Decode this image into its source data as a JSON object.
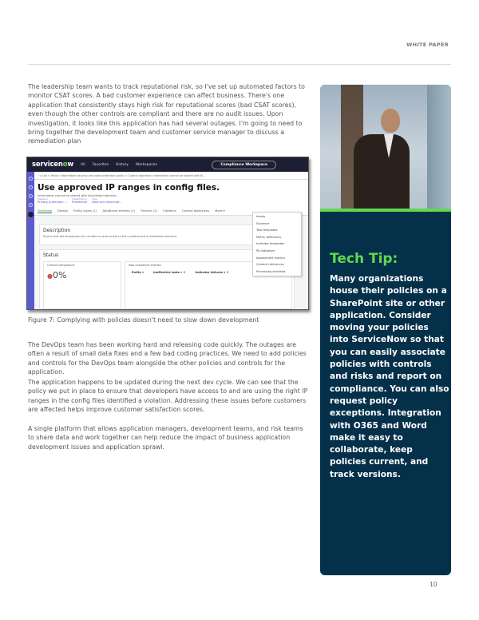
{
  "header": {
    "label": "WHITE PAPER"
  },
  "paragraphs": {
    "intro": "The leadership team wants to track reputational risk, so I've set up automated factors to monitor CSAT scores. A bad customer experience can affect business. There's one application that consistently stays high risk for reputational scores (bad CSAT scores), even though the other controls are compliant and there are no audit issues. Upon investigation, it looks like this application has had several outages. I'm going to need to bring together the development team and customer service manager to discuss a remediation plan",
    "devops": "The DevOps team has been working hard and releasing code quickly. The outages are often a result of small data fixes and a few bad coding practices. We need to add policies and controls for the DevOps team alongside the other policies and controls for the application.",
    "update": "The application happens to be updated during the next dev cycle. We can see that the policy we put in place to ensure that developers have access to and are using the right IP ranges in the config files identified a violation. Addressing these issues before customers are affected helps improve customer satisfaction scores.",
    "platform": "A single platform that allows application managers, development teams, and risk teams to share data and work together can help reduce the impact of business application development issues and application sprawl."
  },
  "figure": {
    "caption": "Figure 7: Complying with policies doesn't need to slow down development",
    "app": {
      "logo_pre": "servicen",
      "logo_o": "o",
      "logo_post": "w",
      "nav": [
        "All",
        "Favorites",
        "History",
        "Workspaces"
      ],
      "workspace_button": "Compliance Workspace",
      "breadcrumb": "< List  >  Policy: Information security and data protection policy  >  Control objective: Information cannot be shared with bl...",
      "title": "Use approved IP ranges in config files.",
      "subtitle": "Information cannot be shared with blacklisted domains",
      "meta": [
        {
          "label": "Category",
          "value": "Privacy protection ..."
        },
        {
          "label": "Classification",
          "value": "Preventive"
        },
        {
          "label": "Type",
          "value": "Data and informati..."
        }
      ],
      "tabs": [
        "Overview",
        "Details",
        "Entity types (1)",
        "Additional entities (1)",
        "Policies (1)",
        "Citations",
        "Control objectives",
        "More ▾"
      ],
      "description": {
        "heading": "Description",
        "text": "Ensure that the employees are not able to send emails to the unauthorized or blacklisted domains."
      },
      "status": {
        "heading": "Status",
        "overall_label": "Overall compliance",
        "overall_value": "0%",
        "noncompliant_label": "Non-compliant entities",
        "columns": [
          "Entity ▾",
          "Ineffective tests ▾ ↕",
          "Indicator failures ▾ ↕"
        ]
      },
      "more_menu": [
        "Issues",
        "Evidence",
        "Test templates",
        "Metric definitions",
        "Indicator templates",
        "PA Indicators",
        "Assessment metrics",
        "Content references",
        "Processing activities"
      ]
    }
  },
  "tip": {
    "heading": "Tech Tip:",
    "body": "Many organizations house their policies on a SharePoint site or other application. Consider moving your policies into ServiceNow so that you can easily associate policies with controls and risks and report on compliance. You can also request policy exceptions. Integration with O365 and Word make it easy to collaborate, keep policies current, and track versions.",
    "colors": {
      "panel": "#05304a",
      "accent": "#62d84e"
    }
  },
  "page_number": "10"
}
